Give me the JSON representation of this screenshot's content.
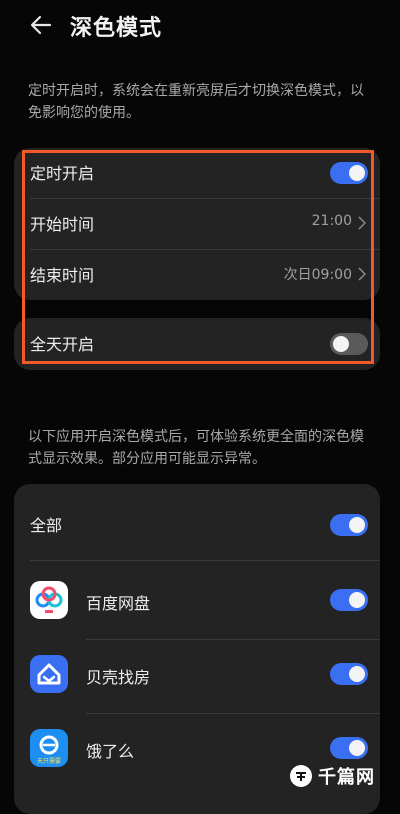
{
  "header": {
    "title": "深色模式",
    "back_icon": "arrow-left-icon"
  },
  "notice_schedule": "定时开启时，系统会在重新亮屏后才切换深色模式，以免影响您的使用。",
  "schedule_card": {
    "scheduled_label": "定时开启",
    "scheduled_on": true,
    "start_label": "开始时间",
    "start_value": "21:00",
    "end_label": "结束时间",
    "end_value": "次日09:00"
  },
  "all_day_card": {
    "label": "全天开启",
    "on": false
  },
  "notice_apps": "以下应用开启深色模式后，可体验系统更全面的深色模式显示效果。部分应用可能显示异常。",
  "apps_card": {
    "all_label": "全部",
    "all_on": true,
    "apps": [
      {
        "name": "百度网盘",
        "icon": "baidu-netdisk-icon",
        "on": true
      },
      {
        "name": "贝壳找房",
        "icon": "beike-icon",
        "on": true
      },
      {
        "name": "饿了么",
        "icon": "eleme-icon",
        "on": true,
        "icon_text": "天只需要"
      }
    ]
  },
  "watermark": {
    "text": "千篇网"
  },
  "colors": {
    "toggle_on": "#3a6ff2",
    "toggle_off": "#5a5a5a",
    "highlight": "#f25a2a"
  }
}
